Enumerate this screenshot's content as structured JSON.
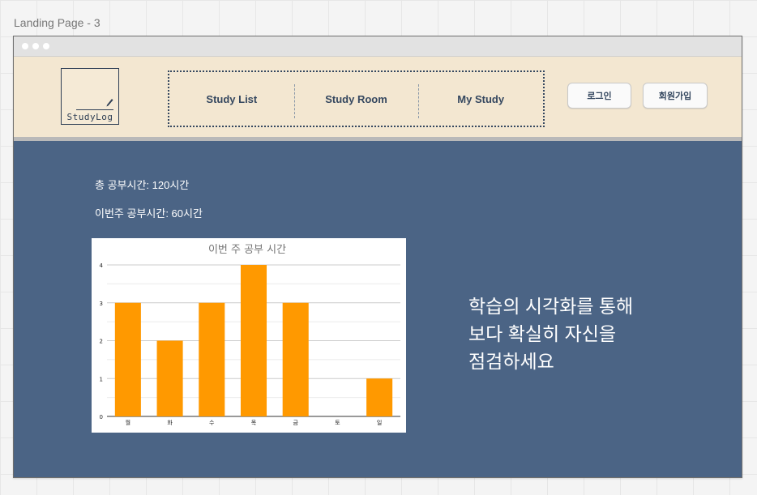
{
  "frame": {
    "title": "Landing Page - 3"
  },
  "header": {
    "logo_text": "StudyLog",
    "nav": [
      {
        "label": "Study List"
      },
      {
        "label": "Study Room"
      },
      {
        "label": "My Study"
      }
    ],
    "login_label": "로그인",
    "signup_label": "회원가입"
  },
  "stats": {
    "total": "총 공부시간: 120시간",
    "week": "이번주 공부시간: 60시간"
  },
  "tagline": [
    "학습의 시각화를 통해",
    "보다 확실히 자신을",
    "점검하세요"
  ],
  "colors": {
    "background": "#4b6485",
    "header": "#f3e7d1",
    "bar": "#ff9900",
    "text_dark": "#34475f"
  },
  "chart_data": {
    "type": "bar",
    "title": "이번 주 공부 시간",
    "categories": [
      "월",
      "화",
      "수",
      "목",
      "금",
      "토",
      "일"
    ],
    "values": [
      3,
      2,
      3,
      4,
      3,
      0,
      1
    ],
    "ylim": [
      0,
      4
    ],
    "yticks": [
      0,
      1,
      2,
      3,
      4
    ],
    "grid": true,
    "legend": "none"
  }
}
